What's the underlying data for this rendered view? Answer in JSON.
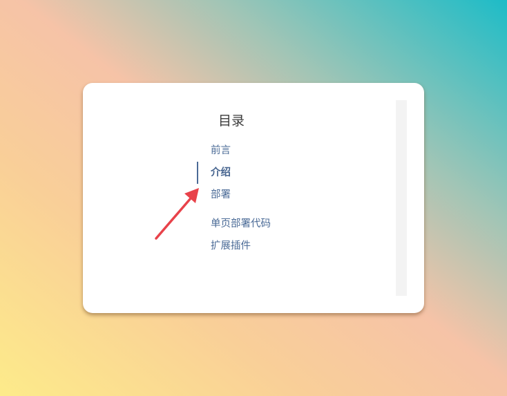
{
  "toc": {
    "title": "目录",
    "items": [
      {
        "label": "前言",
        "active": false
      },
      {
        "label": "介绍",
        "active": true
      },
      {
        "label": "部署",
        "active": false
      },
      {
        "label": "单页部署代码",
        "active": false
      },
      {
        "label": "扩展插件",
        "active": false
      }
    ]
  },
  "annotation": {
    "arrow_color": "#e8424a",
    "icon": "arrow-up-right-icon"
  }
}
